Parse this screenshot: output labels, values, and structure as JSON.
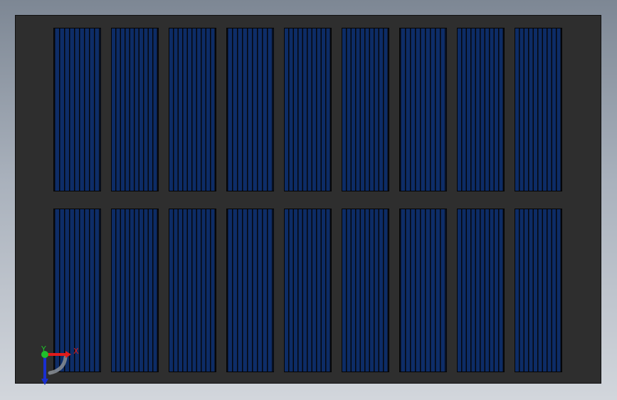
{
  "viewport": {
    "background_color_top": "#7d8794",
    "background_color_bottom": "#d2d6dc"
  },
  "panel": {
    "color": "#2e2e2e",
    "cell_color": "#0b2a63",
    "rows": 2,
    "columns": 9
  },
  "triad": {
    "x_label": "X",
    "y_label": "Y",
    "x_color": "#e11b1b",
    "y_color": "#1fbf2a",
    "z_color": "#1a2fd0"
  }
}
